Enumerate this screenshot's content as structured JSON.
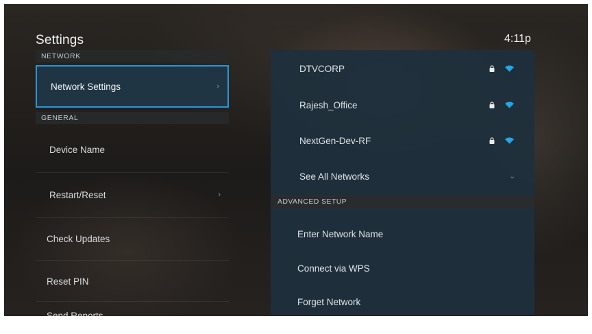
{
  "header": {
    "title": "Settings",
    "clock": "4:11p"
  },
  "sidebar": {
    "network_header": "NETWORK",
    "general_header": "GENERAL",
    "items": [
      {
        "label": "Network Settings",
        "chevron": "›",
        "selected": true
      },
      {
        "label": "Device Name"
      },
      {
        "label": "Restart/Reset",
        "chevron": "›"
      },
      {
        "label": "Check Updates"
      },
      {
        "label": "Reset PIN"
      },
      {
        "label": "Send Reports"
      }
    ]
  },
  "networks": {
    "list": [
      {
        "ssid": "DTVCORP",
        "icons": [
          "lock-icon",
          "wifi-icon"
        ]
      },
      {
        "ssid": "Rajesh_Office",
        "icons": [
          "lock-icon",
          "wifi-icon"
        ]
      },
      {
        "ssid": "NextGen-Dev-RF",
        "icons": [
          "lock-icon",
          "wifi-icon"
        ]
      }
    ],
    "see_all": "See All Networks",
    "see_all_chevron": "⌄",
    "advanced_header": "ADVANCED SETUP",
    "advanced": [
      {
        "label": "Enter Network Name"
      },
      {
        "label": "Connect via WPS"
      },
      {
        "label": "Forget Network"
      }
    ]
  },
  "colors": {
    "accent": "#2b96d6",
    "wifi": "#22a6e6",
    "panel": "#1e303c"
  }
}
